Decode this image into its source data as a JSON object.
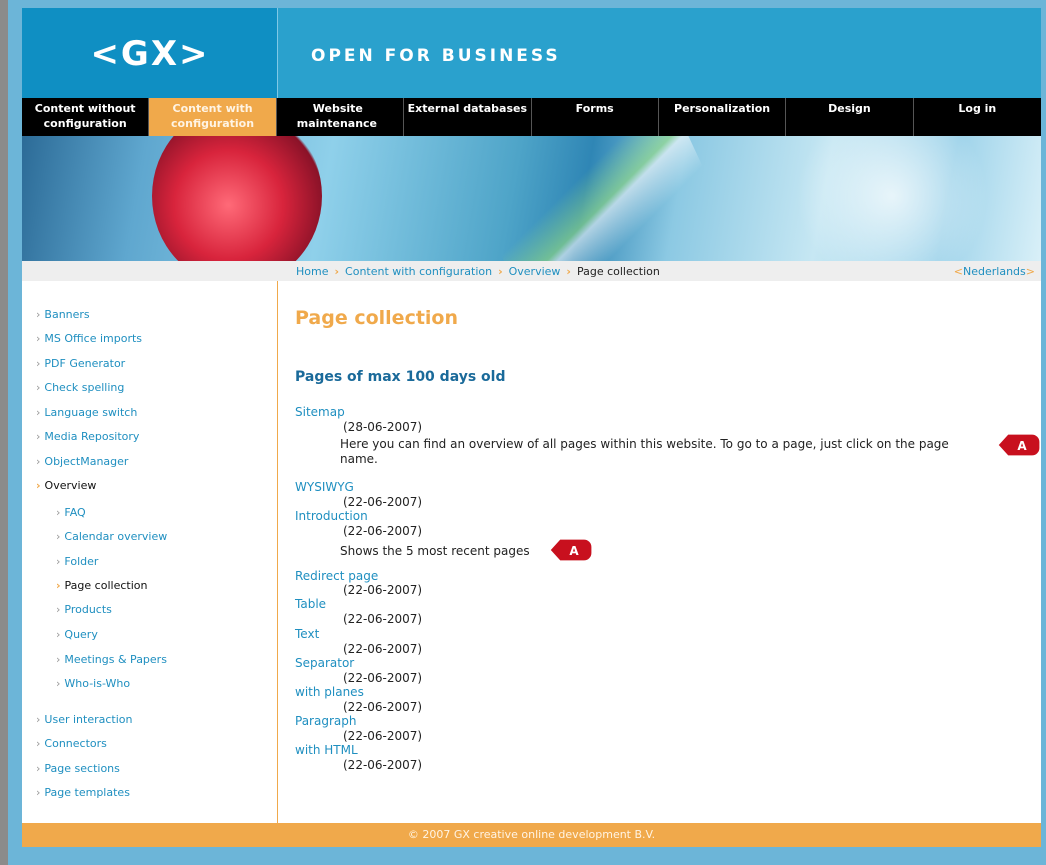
{
  "header": {
    "logo": "<GX>",
    "tagline": "OPEN FOR BUSINESS"
  },
  "nav": {
    "items": [
      {
        "line1": "Content without",
        "line2": "configuration"
      },
      {
        "line1": "Content with",
        "line2": "configuration"
      },
      {
        "line1": "Website",
        "line2": "maintenance"
      },
      {
        "line1": "External databases",
        "line2": ""
      },
      {
        "line1": "Forms",
        "line2": ""
      },
      {
        "line1": "Personalization",
        "line2": ""
      },
      {
        "line1": "Design",
        "line2": ""
      },
      {
        "line1": "Log in",
        "line2": ""
      }
    ]
  },
  "breadcrumb": {
    "home": "Home",
    "level1": "Content with configuration",
    "level2": "Overview",
    "current": "Page collection",
    "lang_open": "<",
    "lang": "Nederlands",
    "lang_close": ">"
  },
  "sidebar": {
    "items": [
      {
        "label": "Banners"
      },
      {
        "label": "MS Office imports"
      },
      {
        "label": "PDF Generator"
      },
      {
        "label": "Check spelling"
      },
      {
        "label": "Language switch"
      },
      {
        "label": "Media Repository"
      },
      {
        "label": "ObjectManager"
      },
      {
        "label": "Overview"
      }
    ],
    "subitems": [
      {
        "label": "FAQ"
      },
      {
        "label": "Calendar overview"
      },
      {
        "label": "Folder"
      },
      {
        "label": "Page collection"
      },
      {
        "label": "Products"
      },
      {
        "label": "Query"
      },
      {
        "label": "Meetings & Papers"
      },
      {
        "label": "Who-is-Who"
      }
    ],
    "bottom_items": [
      {
        "label": "User interaction"
      },
      {
        "label": "Connectors"
      },
      {
        "label": "Page sections"
      },
      {
        "label": "Page templates"
      }
    ]
  },
  "main": {
    "title": "Page collection",
    "section_title": "Pages of max 100 days old",
    "entries": [
      {
        "link": "Sitemap",
        "date": "(28-06-2007)",
        "desc": "Here you can find an overview of all pages within this website. To go to a page, just click on the page name."
      },
      {
        "link": "WYSIWYG",
        "date": "(22-06-2007)"
      },
      {
        "link": "Introduction",
        "date": "(22-06-2007)",
        "desc": "Shows the 5 most recent pages"
      },
      {
        "link": "Redirect page",
        "date": "(22-06-2007)"
      },
      {
        "link": "Table",
        "date": "(22-06-2007)"
      },
      {
        "link": "Text",
        "date": "(22-06-2007)"
      },
      {
        "link": "Separator",
        "date": "(22-06-2007)"
      },
      {
        "link": "with planes",
        "date": "(22-06-2007)"
      },
      {
        "link": "Paragraph",
        "date": "(22-06-2007)"
      },
      {
        "link": "with HTML",
        "date": "(22-06-2007)"
      }
    ],
    "marker_label": "A"
  },
  "footer": {
    "text": "© 2007 GX creative online development B.V."
  },
  "colors": {
    "accent_orange": "#f0a94b",
    "link_blue": "#1f8fc0",
    "header_blue": "#2aa1cd",
    "marker_red": "#c8101e"
  }
}
